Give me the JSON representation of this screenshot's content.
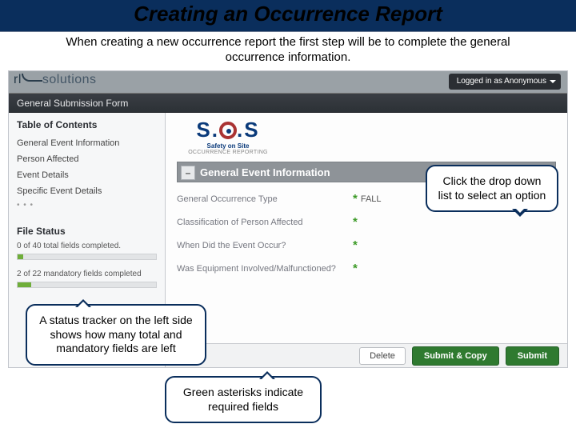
{
  "slide": {
    "title": "Creating an Occurrence Report",
    "subtitle": "When creating a new occurrence report the first step will be to complete the general occurrence information."
  },
  "app": {
    "brand_rl": "rl",
    "brand_sol": "solutions",
    "logged_in_label": "Logged in as Anonymous",
    "form_header": "General Submission Form"
  },
  "sidebar": {
    "toc_header": "Table of Contents",
    "items": [
      {
        "label": "General Event Information"
      },
      {
        "label": "Person Affected"
      },
      {
        "label": "Event Details"
      },
      {
        "label": "Specific Event Details"
      }
    ],
    "dots": "• • •",
    "file_status_header": "File Status",
    "total_line": "0 of 40 total fields completed.",
    "total_pct": "4%",
    "mandatory_line": "2 of 22 mandatory fields completed",
    "mandatory_pct": "10%"
  },
  "main": {
    "logo": {
      "safety_on_site": "Safety on Site",
      "occ_reporting": "OCCURRENCE REPORTING"
    },
    "section_title": "General Event Information",
    "toggle_glyph": "–",
    "fields": [
      {
        "label": "General Occurrence Type",
        "value": "FALL"
      },
      {
        "label": "Classification of Person Affected",
        "value": ""
      },
      {
        "label": "When Did the Event Occur?",
        "value": ""
      },
      {
        "label": "Was Equipment Involved/Malfunctioned?",
        "value": ""
      }
    ],
    "asterisk": "*"
  },
  "footer": {
    "delete": "Delete",
    "submit_copy": "Submit & Copy",
    "submit": "Submit"
  },
  "callouts": {
    "status": "A status tracker on the left side shows how many total and mandatory fields are left",
    "dropdown": "Click the drop down list to select an option",
    "asterisk": "Green asterisks indicate required fields"
  }
}
